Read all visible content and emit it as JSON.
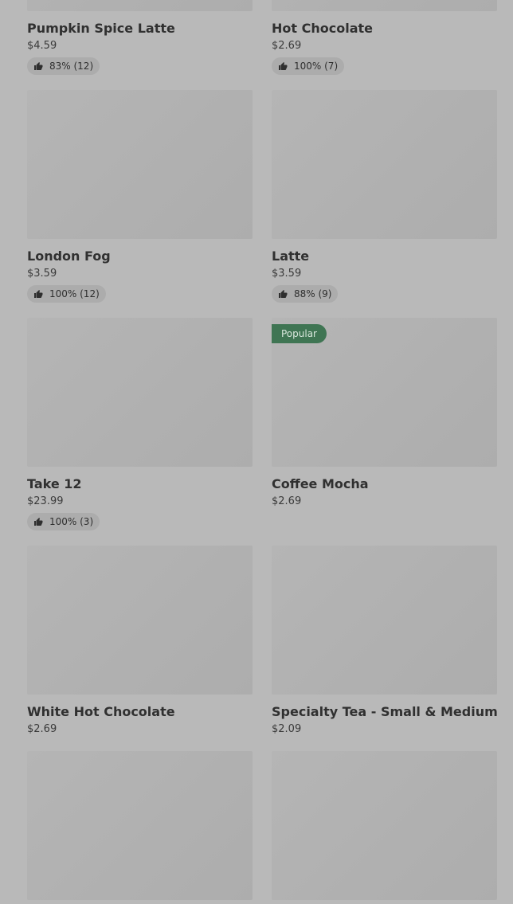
{
  "theme": {
    "background": "#b9b9b9",
    "image_placeholder": "#b0b0b0",
    "popular_badge": "#3f7553",
    "rating_pill": "#acacac"
  },
  "menu": {
    "items": [
      {
        "name": "Pumpkin Spice Latte",
        "price": "$4.59",
        "rating": "83% (12)",
        "badge": "",
        "icon": "thumbs-up-icon"
      },
      {
        "name": "Hot Chocolate",
        "price": "$2.69",
        "rating": "100% (7)",
        "badge": "",
        "icon": "thumbs-up-icon"
      },
      {
        "name": "London Fog",
        "price": "$3.59",
        "rating": "100% (12)",
        "badge": "",
        "icon": "thumbs-up-icon"
      },
      {
        "name": "Latte",
        "price": "$3.59",
        "rating": "88% (9)",
        "badge": "",
        "icon": "thumbs-up-icon"
      },
      {
        "name": "Take 12",
        "price": "$23.99",
        "rating": "100% (3)",
        "badge": "",
        "icon": "thumbs-up-icon"
      },
      {
        "name": "Coffee Mocha",
        "price": "$2.69",
        "rating": "",
        "badge": "Popular",
        "icon": "thumbs-up-icon"
      },
      {
        "name": "White Hot Chocolate",
        "price": "$2.69",
        "rating": "",
        "badge": "",
        "icon": "thumbs-up-icon"
      },
      {
        "name": "Specialty Tea - Small & Medium",
        "price": "$2.09",
        "rating": "",
        "badge": "",
        "icon": "thumbs-up-icon"
      },
      {
        "name": "",
        "price": "",
        "rating": "",
        "badge": "",
        "icon": "thumbs-up-icon"
      },
      {
        "name": "",
        "price": "",
        "rating": "",
        "badge": "",
        "icon": "thumbs-up-icon"
      }
    ]
  }
}
